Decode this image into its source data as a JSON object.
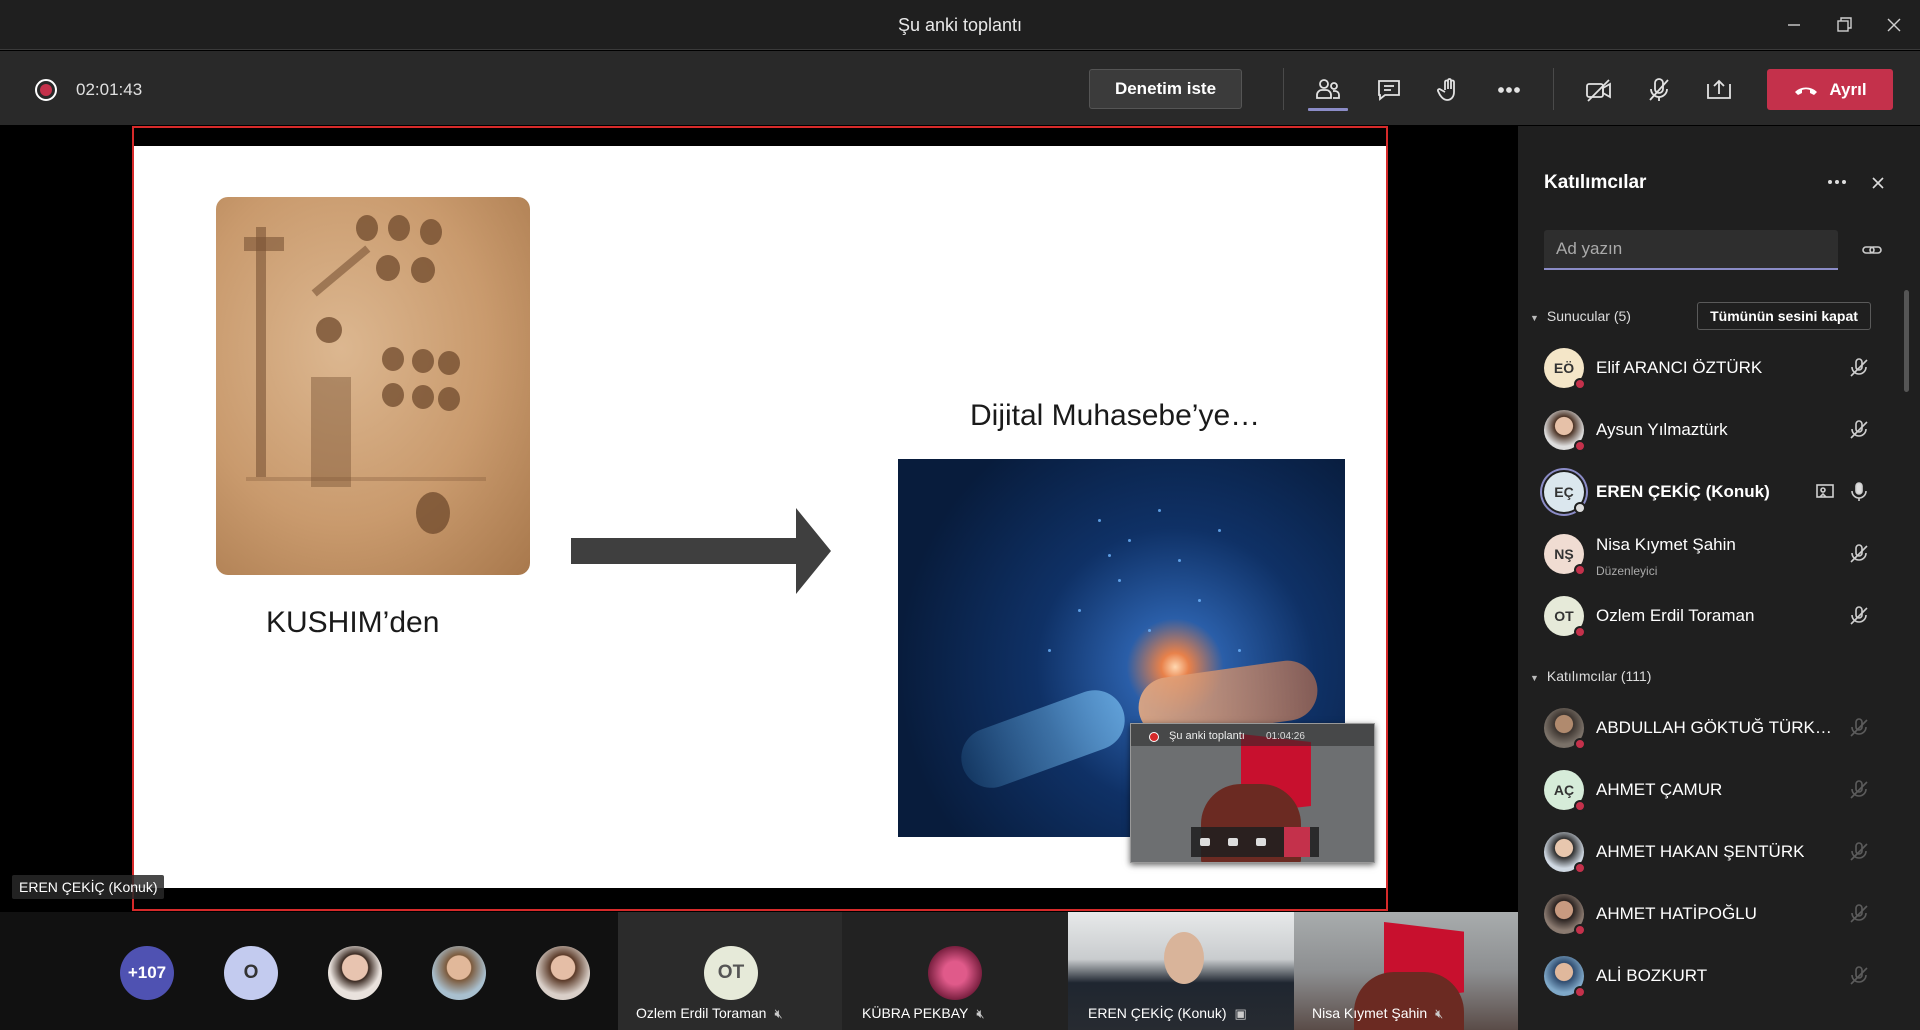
{
  "window": {
    "title": "Şu anki toplantı"
  },
  "toolbar": {
    "timer": "02:01:43",
    "ask_control_label": "Denetim iste",
    "leave_label": "Ayrıl",
    "leave_color": "#c4314b",
    "accent": "#8b8cc7"
  },
  "slide": {
    "left_caption": "KUSHIM’den",
    "right_caption": "Dijital Muhasebe’ye…"
  },
  "pip": {
    "title": "Şu anki toplantı",
    "timer": "01:04:26"
  },
  "presenter_label": "EREN ÇEKİÇ (Konuk)",
  "strip": {
    "overflow_count": "+107",
    "avatar_o": "O",
    "tiles": [
      {
        "initials": "OT",
        "name": "Ozlem Erdil Toraman"
      },
      {
        "name": "KÜBRA PEKBAY"
      },
      {
        "name": "EREN ÇEKİÇ (Konuk)"
      },
      {
        "name": "Nisa Kıymet Şahin"
      }
    ]
  },
  "panel": {
    "title": "Katılımcılar",
    "search_placeholder": "Ad yazın",
    "presenters_header": "Sunucular (5)",
    "mute_all_label": "Tümünün sesini kapat",
    "attendees_header": "Katılımcılar (111)",
    "presenters": [
      {
        "initials": "EÖ",
        "name": "Elif ARANCI ÖZTÜRK"
      },
      {
        "initials": "",
        "name": "Aysun Yılmaztürk"
      },
      {
        "initials": "EÇ",
        "name": "EREN ÇEKİÇ (Konuk)"
      },
      {
        "initials": "NŞ",
        "name": "Nisa Kıymet Şahin",
        "role": "Düzenleyici"
      },
      {
        "initials": "OT",
        "name": "Ozlem Erdil Toraman"
      }
    ],
    "attendees": [
      {
        "initials": "",
        "name": "ABDULLAH GÖKTUĞ TÜRKO..."
      },
      {
        "initials": "AÇ",
        "name": "AHMET ÇAMUR"
      },
      {
        "initials": "",
        "name": "AHMET HAKAN ŞENTÜRK"
      },
      {
        "initials": "",
        "name": "AHMET HATİPOĞLU"
      },
      {
        "initials": "",
        "name": "ALİ BOZKURT"
      }
    ]
  }
}
